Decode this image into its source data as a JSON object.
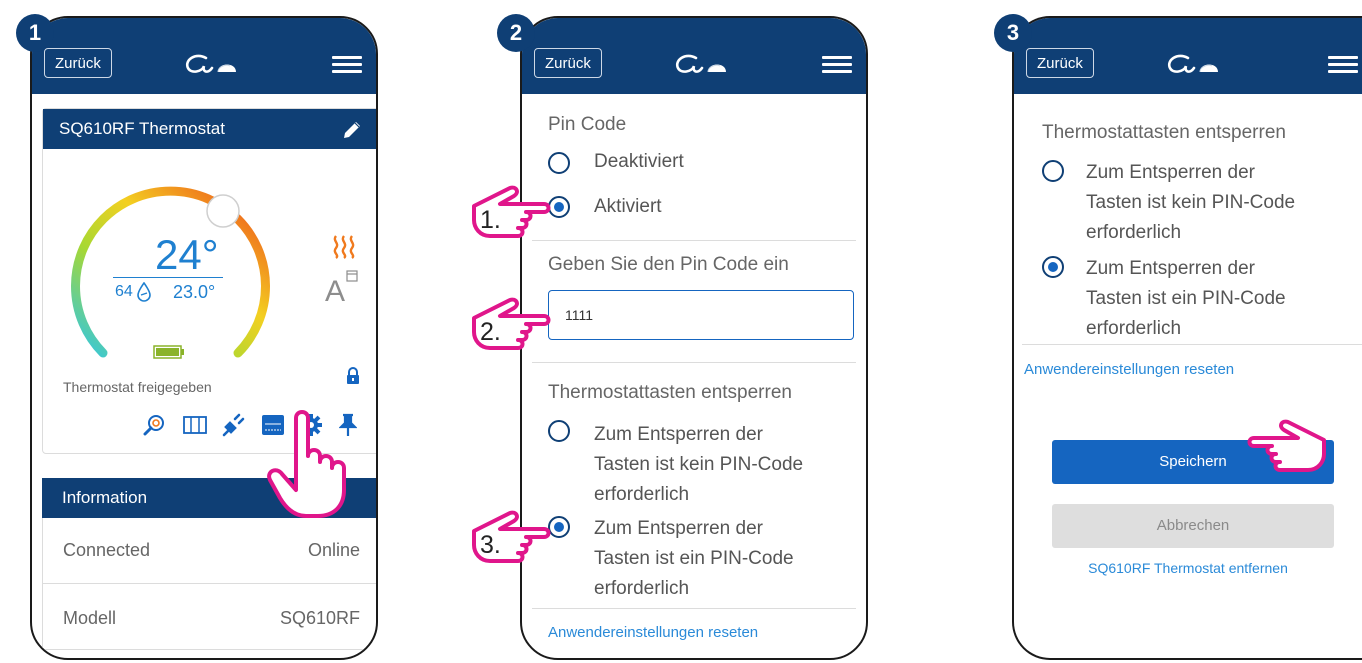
{
  "common": {
    "back_label": "Zurück",
    "colors": {
      "header": "#0f3f75",
      "accent": "#1565c0",
      "link": "#2a8ad8",
      "hand": "#e0168b"
    }
  },
  "steps": [
    "1",
    "2",
    "3"
  ],
  "panel1": {
    "device_title": "SQ610RF Thermostat",
    "temperature": "24°",
    "humidity": "64",
    "current_temp": "23.0°",
    "status": "Thermostat freigegeben",
    "info_title": "Information",
    "rows": [
      {
        "label": "Connected",
        "value": "Online"
      },
      {
        "label": "Modell",
        "value": "SQ610RF"
      }
    ],
    "icons": [
      "search-icon",
      "window-icon",
      "plug-icon",
      "keyboard-icon",
      "gear-icon",
      "pin-icon"
    ]
  },
  "panel2": {
    "pin_heading": "Pin Code",
    "opt_off": "Deaktiviert",
    "opt_on": "Aktiviert",
    "pin_prompt": "Geben Sie den Pin Code ein",
    "pin_value": "1111",
    "unlock_heading": "Thermostattasten entsperren",
    "unlock_opt1": [
      "Zum Entsperren der",
      "Tasten ist kein PIN-Code",
      "erforderlich"
    ],
    "unlock_opt2": [
      "Zum Entsperren der",
      "Tasten ist ein PIN-Code",
      "erforderlich"
    ],
    "reset_link": "Anwendereinstellungen reseten",
    "hand_labels": [
      "1.",
      "2.",
      "3."
    ]
  },
  "panel3": {
    "unlock_heading": "Thermostattasten entsperren",
    "unlock_opt1": [
      "Zum Entsperren der",
      "Tasten ist kein PIN-Code",
      "erforderlich"
    ],
    "unlock_opt2": [
      "Zum Entsperren der",
      "Tasten ist ein PIN-Code",
      "erforderlich"
    ],
    "reset_link": "Anwendereinstellungen reseten",
    "save": "Speichern",
    "cancel": "Abbrechen",
    "remove_link": "SQ610RF Thermostat entfernen"
  }
}
